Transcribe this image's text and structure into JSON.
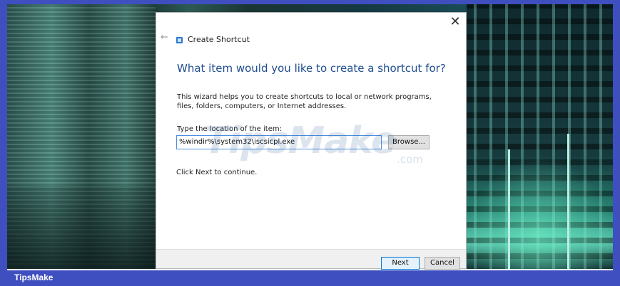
{
  "dialog": {
    "title": "Create Shortcut",
    "close_glyph": "✕",
    "back_glyph": "←",
    "heading": "What item would you like to create a shortcut for?",
    "description": "This wizard helps you to create shortcuts to local or network programs, files, folders, computers, or Internet addresses.",
    "field_label": "Type the location of the item:",
    "location_value": "%windir%\\system32\\iscsicpl.exe",
    "browse_label": "Browse...",
    "hint": "Click Next to continue.",
    "next_label": "Next",
    "cancel_label": "Cancel",
    "icon": "shortcut-wizard-icon"
  },
  "watermark": {
    "text": "TipsMake",
    "suffix": ".com"
  },
  "footer": {
    "brand": "TipsMake"
  },
  "colors": {
    "frame": "#3f4fc0",
    "heading": "#1f4c8f",
    "input_border": "#4a90e2",
    "primary_button_border": "#0078d7"
  }
}
